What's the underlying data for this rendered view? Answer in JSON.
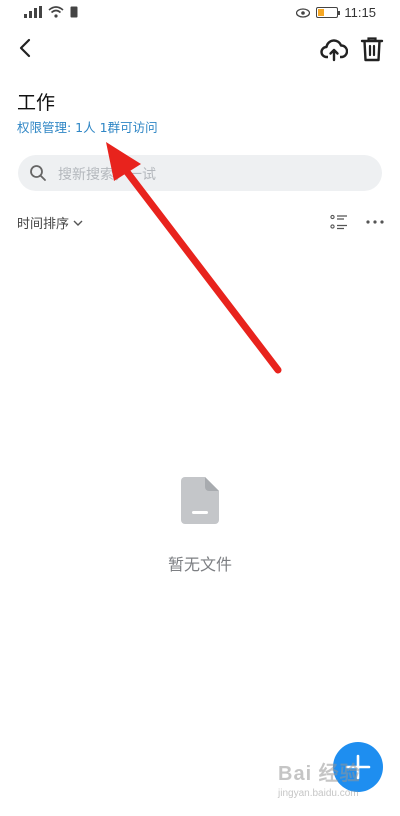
{
  "status_bar": {
    "signal_text": "4G",
    "time": "11:15",
    "battery_level": 0.3
  },
  "header": {
    "title": "工作",
    "permission_label": "权限管理: 1人 1群可访问",
    "back_icon": "back-arrow-icon",
    "upload_icon": "cloud-upload-icon",
    "delete_icon": "trash-icon"
  },
  "search": {
    "placeholder": "搜新搜索，一试"
  },
  "toolbar": {
    "sort_label": "时间排序"
  },
  "empty_state": {
    "message": "暂无文件"
  },
  "watermark": {
    "main": "Bai 经验",
    "sub": "jingyan.baidu.com"
  },
  "colors": {
    "accent": "#1e8ef0",
    "link": "#2f86c5",
    "annotation_arrow": "#e8231d"
  }
}
